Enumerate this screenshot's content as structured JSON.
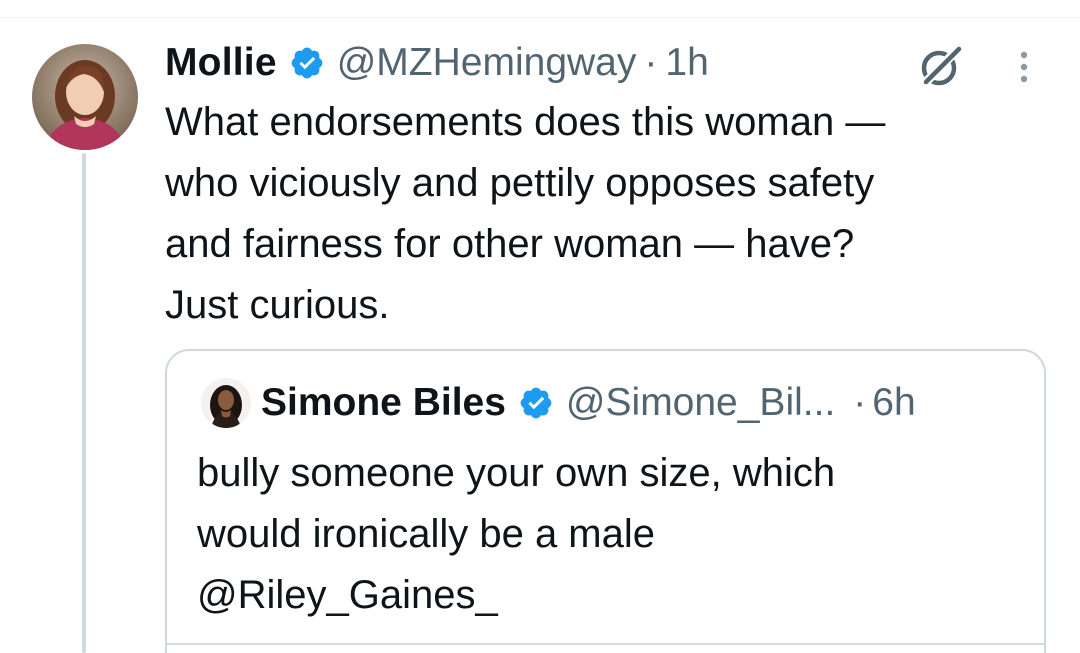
{
  "tweet": {
    "author_name": "Mollie",
    "author_handle": "@MZHemingway",
    "separator": "·",
    "time": "1h",
    "text_lines": [
      "What endorsements does this woman —",
      "who viciously and pettily opposes safety",
      "and fairness for other woman — have?",
      "Just curious."
    ]
  },
  "quote": {
    "author_name": "Simone Biles",
    "author_handle": "@Simone_Bil...",
    "separator": "·",
    "time": "6h",
    "text_lines": [
      "bully someone your own size, which",
      "would ironically be a male",
      "@Riley_Gaines_"
    ]
  },
  "icons": {
    "verified": "verified-badge-icon",
    "grok": "grok-icon",
    "more": "more-options-icon"
  },
  "colors": {
    "verified_blue": "#1d9bf0",
    "text_primary": "#0f1419",
    "text_secondary": "#536471",
    "border": "#cfd9de"
  }
}
